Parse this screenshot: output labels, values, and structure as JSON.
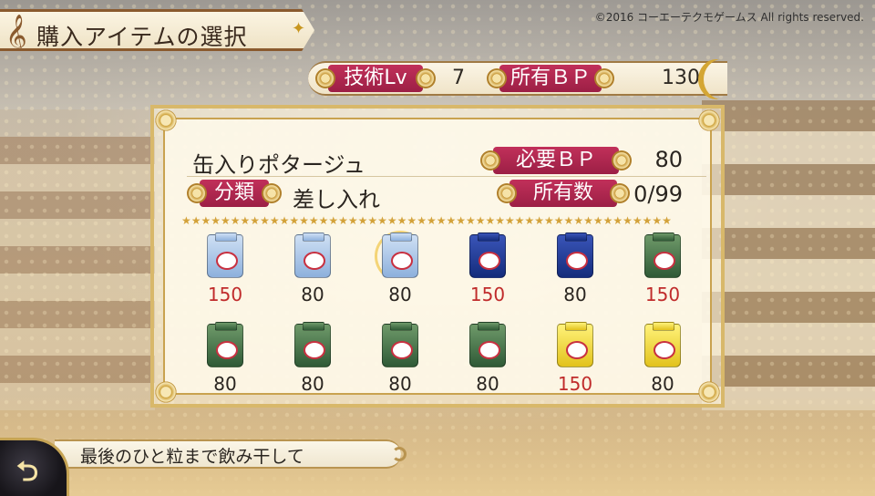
{
  "screen": {
    "title": "購入アイテムの選択",
    "copyright": "©2016 コーエーテクモゲームス All rights reserved."
  },
  "stats": {
    "skill_label": "技術Lv",
    "skill_value": "7",
    "bp_label": "所有ＢＰ",
    "bp_value": "130"
  },
  "item": {
    "name": "缶入りポタージュ",
    "required_bp_label": "必要ＢＰ",
    "required_bp_value": "80",
    "category_label": "分類",
    "category_value": "差し入れ",
    "owned_label": "所有数",
    "owned_value": "0/99"
  },
  "star_row": "★★★★★★★★★★★★★★★★★★★★★★★★★★★★★★★★★★★★★★★★★★★★★★★★★★",
  "items": [
    {
      "icon": "bag-light-blue-icon",
      "color": "blue-light",
      "price": "150",
      "affordable": false
    },
    {
      "icon": "bag-light-blue-icon",
      "color": "blue-light",
      "price": "80",
      "affordable": true
    },
    {
      "icon": "bag-light-blue-icon",
      "color": "blue-light",
      "price": "80",
      "affordable": true,
      "selected": true
    },
    {
      "icon": "bag-dark-blue-icon",
      "color": "blue-dark",
      "price": "150",
      "affordable": false
    },
    {
      "icon": "bag-dark-blue-icon",
      "color": "blue-dark",
      "price": "80",
      "affordable": true
    },
    {
      "icon": "bag-green-icon",
      "color": "green",
      "price": "150",
      "affordable": false
    },
    {
      "icon": "bag-green-icon",
      "color": "green",
      "price": "80",
      "affordable": true
    },
    {
      "icon": "bag-green-icon",
      "color": "green",
      "price": "80",
      "affordable": true
    },
    {
      "icon": "bag-green-icon",
      "color": "green",
      "price": "80",
      "affordable": true
    },
    {
      "icon": "bag-green-icon",
      "color": "green",
      "price": "80",
      "affordable": true
    },
    {
      "icon": "bag-yellow-icon",
      "color": "yellow",
      "price": "150",
      "affordable": false
    },
    {
      "icon": "bag-yellow-icon",
      "color": "yellow",
      "price": "80",
      "affordable": true
    }
  ],
  "description": "最後のひと粒まで飲み干して",
  "back_button": {
    "icon": "back-arrow-icon",
    "glyph": "⮌"
  },
  "colors": {
    "pill": "#b0284f",
    "price_high": "#c02b2b",
    "frame_gold": "#d8b86a"
  }
}
